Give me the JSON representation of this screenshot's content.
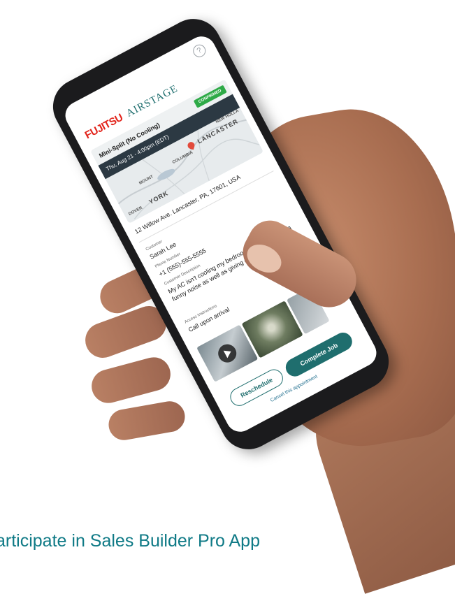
{
  "help": {
    "icon": "help-circle-icon",
    "glyph": "?"
  },
  "brand": {
    "fujitsu": "FUJITSU",
    "airstage": "AIRSTAGE"
  },
  "appointment": {
    "title": "Mini-Split (No Cooling)",
    "status": "CONFIRMED",
    "datetime": "Thu, Aug 21 - 4:00pm (EDT)",
    "map_labels": {
      "lancaster": "LANCASTER",
      "new_holland": "NEW HOLLA",
      "mount": "MOUNT",
      "columbia": "COLUMBIA",
      "dover": "DOVER",
      "york": "YORK"
    },
    "address": "12 Willow Ave. Lancaster, PA, 17601, USA"
  },
  "customer": {
    "name_label": "Customer",
    "name": "Sarah Lee",
    "phone_label": "Phone Number",
    "phone": "+1 (555)-555-5555",
    "description_label": "Customer Description",
    "description": "My AC isn't cooling my bedroom and it's making a funny noise as well as giving off a strange smell.",
    "access_label": "Access Instructions",
    "access": "Call upon arrival"
  },
  "actions": {
    "reschedule": "Reschedule",
    "complete": "Complete Job",
    "cancel": "Cancel this appointment"
  },
  "caption": "articipate in Sales Builder Pro App",
  "colors": {
    "accent": "#1f6e6e",
    "fujitsu_red": "#e2231a",
    "confirmed_green": "#2eaa47",
    "caption": "#0f7a86"
  }
}
